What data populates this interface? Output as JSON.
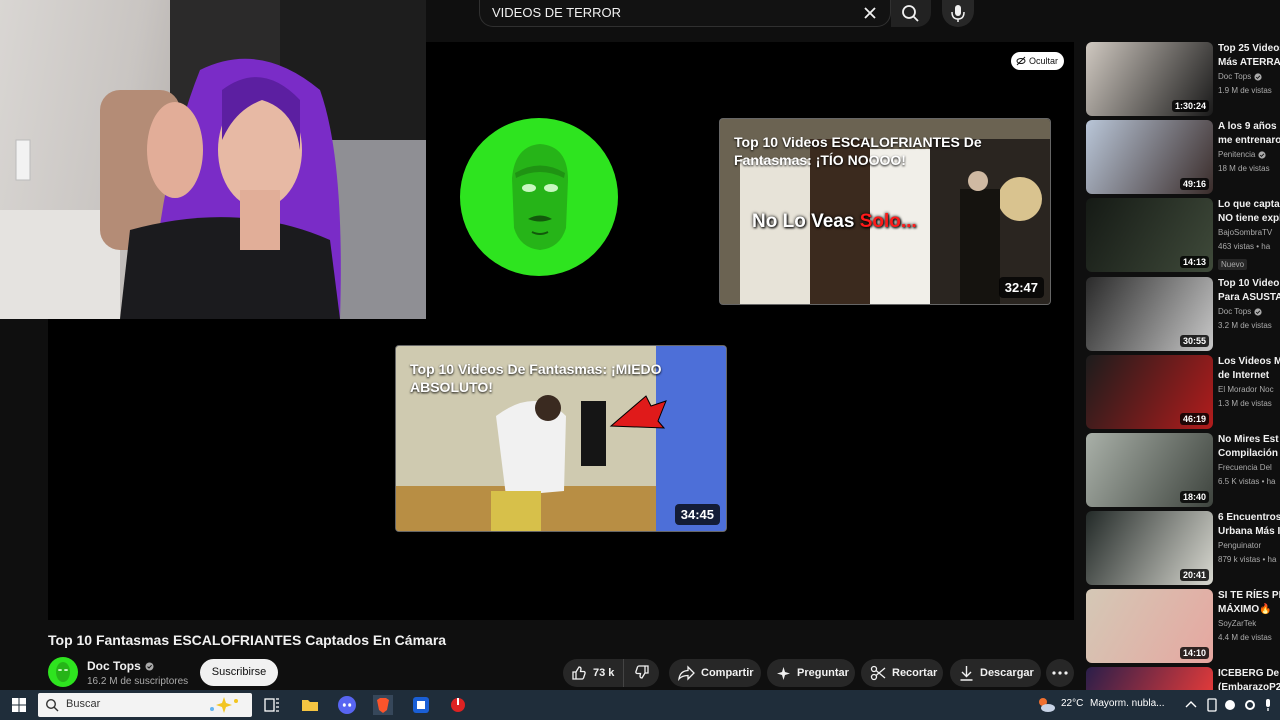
{
  "search": {
    "query": "VIDEOS DE TERROR"
  },
  "player": {
    "hide_label": "Ocultar",
    "end_cards": [
      {
        "title": "Top 10 Videos ESCALOFRIANTES De Fantasmas: ¡TÍO NOOOO!",
        "overlay_text": "No Lo Veas",
        "overlay_text_red": "Solo...",
        "duration": "32:47"
      },
      {
        "title": "Top 10 Videos De Fantasmas: ¡MIEDO ABSOLUTO!",
        "duration": "34:45"
      }
    ]
  },
  "video": {
    "title": "Top 10 Fantasmas ESCALOFRIANTES Captados En Cámara",
    "channel": "Doc Tops",
    "subscribers": "16.2 M de suscriptores",
    "subscribe_label": "Suscribirse",
    "likes": "73 k",
    "share_label": "Compartir",
    "ask_label": "Preguntar",
    "clip_label": "Recortar",
    "download_label": "Descargar"
  },
  "sidebar": {
    "items": [
      {
        "title1": "Top 25 Videos",
        "title2": "Más ATERRA",
        "channel": "Doc Tops",
        "verified": true,
        "views": "1.9 M de vistas",
        "duration": "1:30:24",
        "badge": ""
      },
      {
        "title1": "A los 9 años",
        "title2": "me entrenaro",
        "channel": "Penitencia",
        "verified": true,
        "views": "18 M de vistas",
        "duration": "49:16",
        "badge": ""
      },
      {
        "title1": "Lo que capta",
        "title2": "NO tiene expl",
        "channel": "BajoSombraTV",
        "verified": false,
        "views": "463 vistas • ha",
        "duration": "14:13",
        "badge": "Nuevo"
      },
      {
        "title1": "Top 10 Video",
        "title2": "Para ASUSTA",
        "channel": "Doc Tops",
        "verified": true,
        "views": "3.2 M de vistas",
        "duration": "30:55",
        "badge": ""
      },
      {
        "title1": "Los Videos M",
        "title2": "de Internet",
        "channel": "El Morador Noc",
        "verified": false,
        "views": "1.3 M de vistas",
        "duration": "46:19",
        "badge": ""
      },
      {
        "title1": "No Mires Est",
        "title2": "Compilación",
        "channel": "Frecuencia Del",
        "verified": false,
        "views": "6.5 K vistas • ha",
        "duration": "18:40",
        "badge": ""
      },
      {
        "title1": "6 Encuentros",
        "title2": "Urbana Más I",
        "channel": "Penguinator",
        "verified": false,
        "views": "879 k vistas • ha",
        "duration": "20:41",
        "badge": ""
      },
      {
        "title1": "SI TE RÍES PI",
        "title2": "MÁXIMO🔥",
        "channel": "SoyZarTek",
        "verified": false,
        "views": "4.4 M de vistas",
        "duration": "14:10",
        "badge": ""
      },
      {
        "title1": "ICEBERG De A",
        "title2": "(EmbarazoP2",
        "channel": "",
        "verified": false,
        "views": "",
        "duration": "",
        "badge": ""
      }
    ]
  },
  "taskbar": {
    "search_placeholder": "Buscar",
    "temperature": "22°C",
    "weather": "Mayorm. nubla..."
  }
}
